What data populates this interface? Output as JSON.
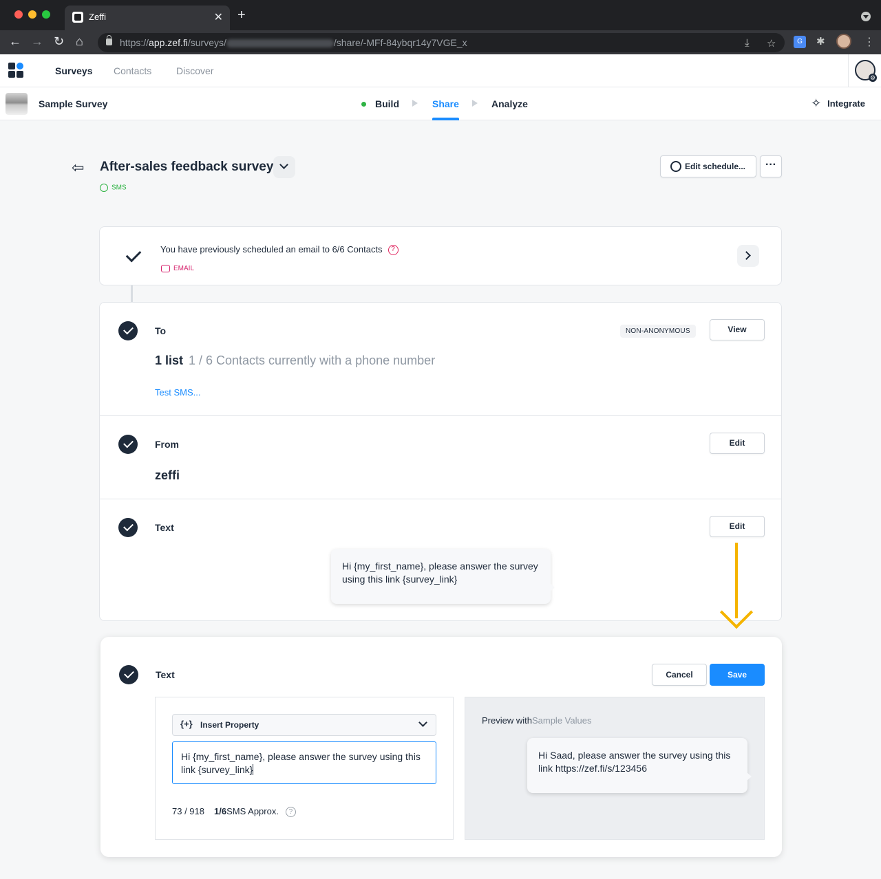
{
  "browser": {
    "tab_title": "Zeffi",
    "url_prefix": "https://",
    "url_host": "app.zef.fi",
    "url_path1": "/surveys/",
    "url_path2": "/share/-MFf-84ybqr14y7VGE_x"
  },
  "app_nav": {
    "surveys": "Surveys",
    "contacts": "Contacts",
    "discover": "Discover"
  },
  "subheader": {
    "survey_name": "Sample Survey",
    "steps": {
      "build": "Build",
      "share": "Share",
      "analyze": "Analyze"
    },
    "integrate": "Integrate"
  },
  "page": {
    "title": "After-sales feedback survey",
    "channel_tag": "SMS",
    "edit_schedule": "Edit schedule...",
    "more": "···"
  },
  "previous": {
    "text": "You have previously scheduled an email to 6/6 Contacts",
    "help": "?",
    "channel_tag": "EMAIL"
  },
  "to_section": {
    "label": "To",
    "badge": "NON-ANONYMOUS",
    "view_button": "View",
    "count": "1 list",
    "description": "1 / 6 Contacts currently with a phone number",
    "test_link": "Test SMS..."
  },
  "from_section": {
    "label": "From",
    "edit_button": "Edit",
    "value": "zeffi"
  },
  "text_section": {
    "label": "Text",
    "edit_button": "Edit",
    "message": "Hi {my_first_name}, please answer the survey using this link {survey_link}"
  },
  "text_editor": {
    "label": "Text",
    "cancel_button": "Cancel",
    "save_button": "Save",
    "insert_property": "Insert Property",
    "input_value": "Hi {my_first_name}, please answer the survey using this link {survey_link}",
    "char_count": "73 / 918",
    "sms_segments": "1/6",
    "sms_approx": "SMS Approx.",
    "help": "?",
    "preview_label": "Preview with",
    "preview_sample": "Sample Values",
    "preview_message": "Hi Saad, please answer the survey using this link https://zef.fi/s/123456"
  },
  "colors": {
    "accent": "#1a8cff",
    "annotation_arrow": "#f5b400",
    "sms_green": "#2fb344",
    "email_pink": "#d6246e"
  }
}
